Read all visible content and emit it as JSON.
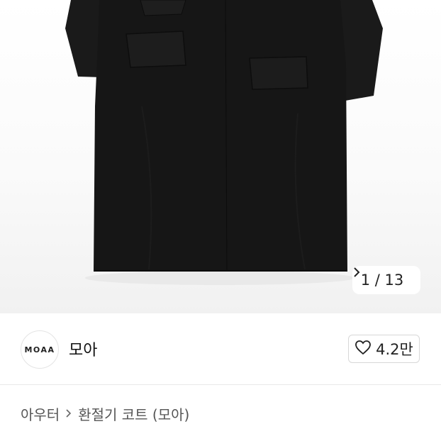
{
  "gallery": {
    "current": "1",
    "separator": "/",
    "total": "13",
    "next_icon": "chevron-right-icon"
  },
  "seller": {
    "logo_text": "MOAA",
    "name": "모아",
    "like_icon": "heart-outline-icon",
    "like_count": "4.2만"
  },
  "breadcrumb": {
    "category": "아우터",
    "separator_icon": "chevron-right-icon",
    "product": "환절기 코트 (모아)"
  },
  "colors": {
    "coat": "#161616",
    "border": "#e9e9e9"
  }
}
